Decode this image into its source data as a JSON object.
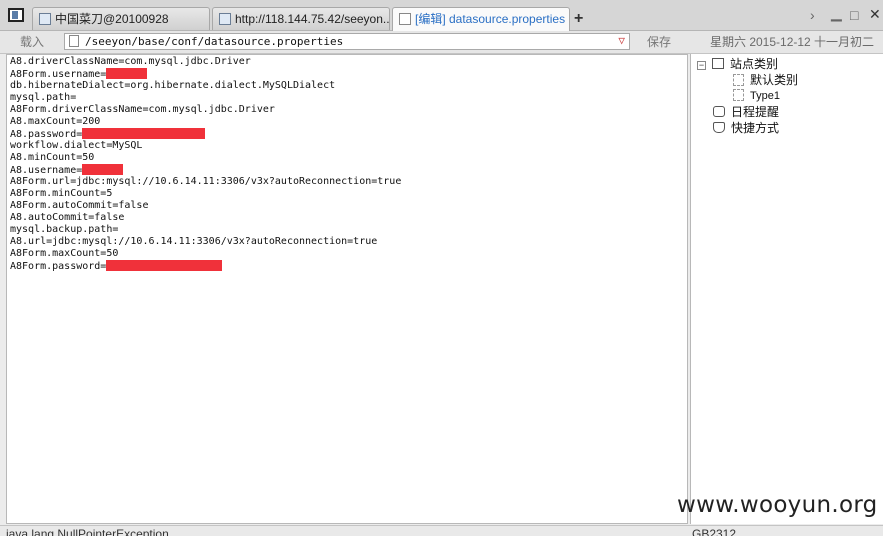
{
  "tabs": [
    {
      "label": "中国菜刀@20100928",
      "active": false
    },
    {
      "label": "http://118.144.75.42/seeyon...",
      "active": false
    },
    {
      "label": "[编辑] datasource.properties",
      "active": true
    }
  ],
  "toolbar": {
    "load_label": "载入",
    "address": "/seeyon/base/conf/datasource.properties",
    "save_label": "保存",
    "date": "星期六 2015-12-12 十一月初二"
  },
  "editor": {
    "lines": [
      {
        "text": "A8.driverClassName=com.mysql.jdbc.Driver"
      },
      {
        "text": "A8Form.username=",
        "redacted": true,
        "redact_width": 0.06
      },
      {
        "text": "db.hibernateDialect=org.hibernate.dialect.MySQLDialect"
      },
      {
        "text": "mysql.path="
      },
      {
        "text": "A8Form.driverClassName=com.mysql.jdbc.Driver"
      },
      {
        "text": "A8.maxCount=200"
      },
      {
        "text": "A8.password=",
        "redacted": true,
        "redact_width": 0.18
      },
      {
        "text": "workflow.dialect=MySQL"
      },
      {
        "text": "A8.minCount=50"
      },
      {
        "text": "A8.username=",
        "redacted": true,
        "redact_width": 0.06
      },
      {
        "text": "A8Form.url=jdbc:mysql://10.6.14.11:3306/v3x?autoReconnection=true"
      },
      {
        "text": "A8Form.minCount=5"
      },
      {
        "text": "A8Form.autoCommit=false"
      },
      {
        "text": "A8.autoCommit=false"
      },
      {
        "text": "mysql.backup.path="
      },
      {
        "text": "A8.url=jdbc:mysql://10.6.14.11:3306/v3x?autoReconnection=true"
      },
      {
        "text": "A8Form.maxCount=50"
      },
      {
        "text": "A8Form.password=",
        "redacted": true,
        "redact_width": 0.17
      }
    ]
  },
  "sidebar": {
    "root_label": "站点类别",
    "child_1": "默认类别",
    "child_2": "Type1",
    "item_schedule": "日程提醒",
    "item_shortcut": "快捷方式"
  },
  "statusbar": {
    "left_text": "java.lang.NullPointerException",
    "right_text": "GB2312"
  },
  "watermark": "www.wooyun.org",
  "colors": {
    "redaction": "#f0313a",
    "active_tab_text": "#2a6fc4"
  }
}
